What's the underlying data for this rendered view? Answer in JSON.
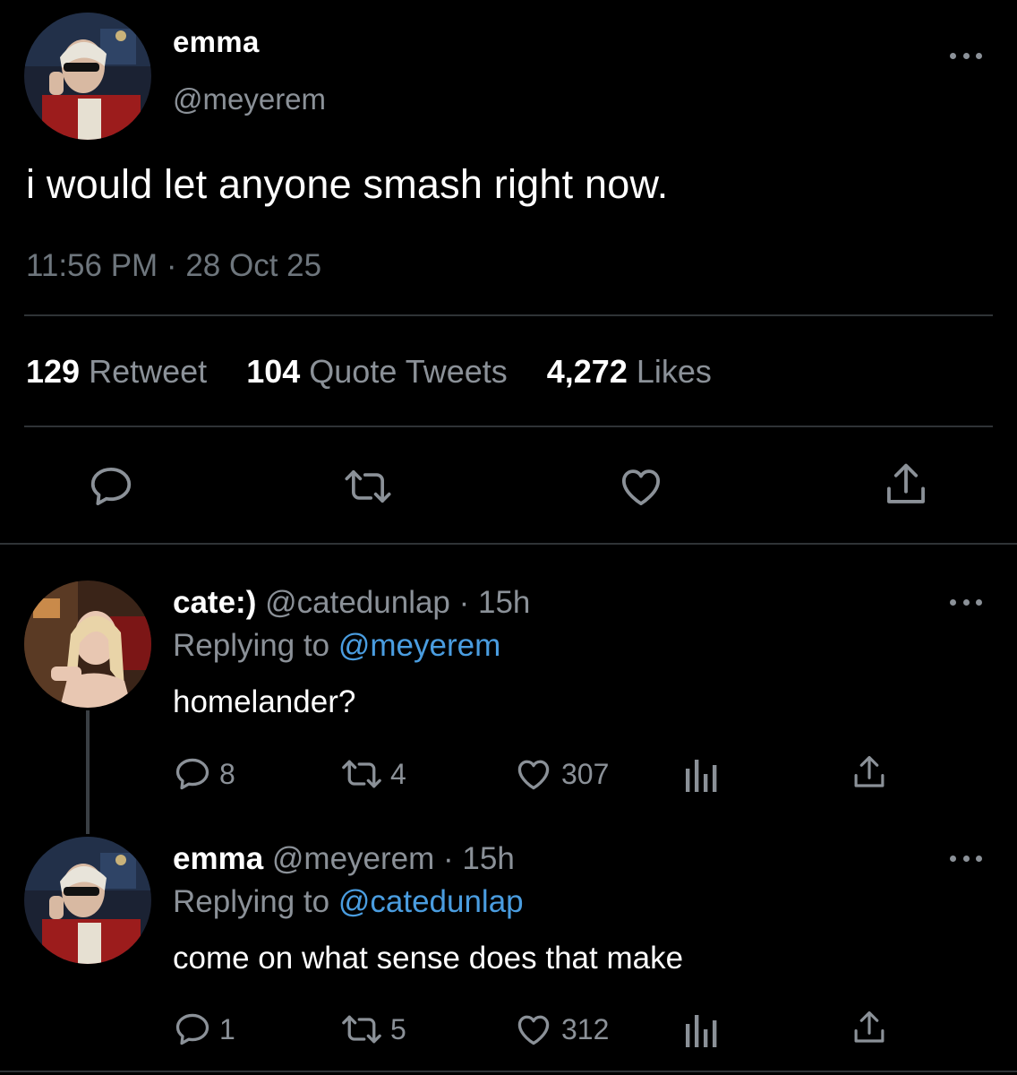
{
  "main_tweet": {
    "display_name": "emma",
    "handle": "@meyerem",
    "text": "i would let anyone smash right now.",
    "timestamp": "11:56 PM · 28 Oct 25",
    "stats": [
      {
        "count": "129",
        "label": "Retweet"
      },
      {
        "count": "104",
        "label": "Quote Tweets"
      },
      {
        "count": "4,272",
        "label": "Likes"
      }
    ],
    "actions": [
      "reply-icon",
      "retweet-icon",
      "like-icon",
      "share-icon"
    ]
  },
  "replies": [
    {
      "display_name": "cate:)",
      "meta": "@catedunlap · 15h",
      "replying_prefix": "Replying to",
      "replying_to": "@meyerem",
      "text": "homelander?",
      "reply_count": "8",
      "retweet_count": "4",
      "like_count": "307"
    },
    {
      "display_name": "emma",
      "meta": "@meyerem · 15h",
      "replying_prefix": "Replying to",
      "replying_to": "@catedunlap",
      "text": "come on what sense does that make",
      "reply_count": "1",
      "retweet_count": "5",
      "like_count": "312"
    }
  ],
  "colors": {
    "background": "#000000",
    "primary_text": "#ffffff",
    "secondary_text": "#8b9198",
    "mention": "#4a9de0",
    "divider": "#2f3336"
  }
}
